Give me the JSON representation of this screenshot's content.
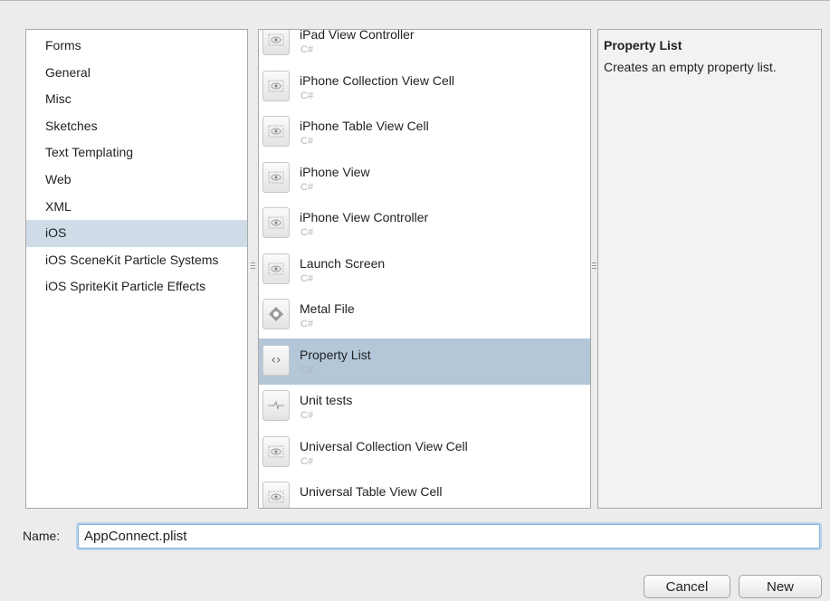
{
  "categories": [
    {
      "label": "Forms",
      "selected": false
    },
    {
      "label": "General",
      "selected": false
    },
    {
      "label": "Misc",
      "selected": false
    },
    {
      "label": "Sketches",
      "selected": false
    },
    {
      "label": "Text Templating",
      "selected": false
    },
    {
      "label": "Web",
      "selected": false
    },
    {
      "label": "XML",
      "selected": false
    },
    {
      "label": "iOS",
      "selected": true
    },
    {
      "label": "iOS SceneKit Particle Systems",
      "selected": false
    },
    {
      "label": "iOS SpriteKit Particle Effects",
      "selected": false
    }
  ],
  "templates": [
    {
      "name": "iPad View Controller",
      "lang": "C#",
      "icon": "eye-icon",
      "selected": false
    },
    {
      "name": "iPhone Collection View Cell",
      "lang": "C#",
      "icon": "eye-icon",
      "selected": false
    },
    {
      "name": "iPhone Table View Cell",
      "lang": "C#",
      "icon": "eye-icon",
      "selected": false
    },
    {
      "name": "iPhone View",
      "lang": "C#",
      "icon": "eye-icon",
      "selected": false
    },
    {
      "name": "iPhone View Controller",
      "lang": "C#",
      "icon": "eye-icon",
      "selected": false
    },
    {
      "name": "Launch Screen",
      "lang": "C#",
      "icon": "eye-icon",
      "selected": false
    },
    {
      "name": "Metal File",
      "lang": "C#",
      "icon": "metal-icon",
      "selected": false
    },
    {
      "name": "Property List",
      "lang": "C#",
      "icon": "angle-brackets-icon",
      "selected": true
    },
    {
      "name": "Unit tests",
      "lang": "C#",
      "icon": "pulse-icon",
      "selected": false
    },
    {
      "name": "Universal Collection View Cell",
      "lang": "C#",
      "icon": "eye-icon",
      "selected": false
    },
    {
      "name": "Universal Table View Cell",
      "lang": "",
      "icon": "eye-icon",
      "selected": false
    }
  ],
  "description": {
    "title": "Property List",
    "text": "Creates an empty property list."
  },
  "name_field": {
    "label": "Name:",
    "value": "AppConnect.plist"
  },
  "buttons": {
    "cancel": "Cancel",
    "new": "New"
  },
  "colors": {
    "category_selected": "#cfdce8",
    "template_selected": "#b3c7d9"
  }
}
